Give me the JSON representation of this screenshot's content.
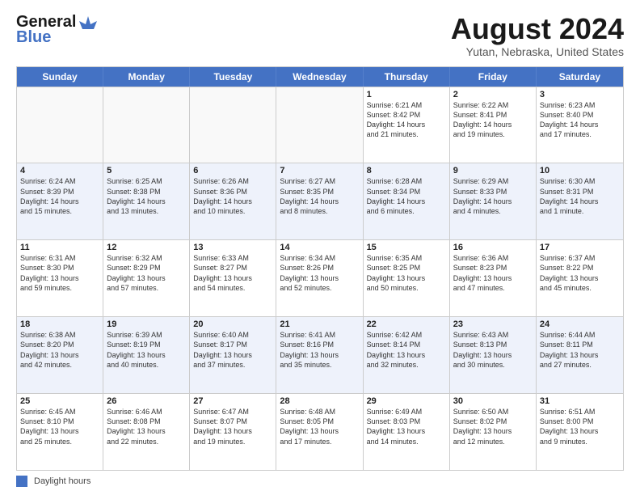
{
  "logo": {
    "line1": "General",
    "line2": "Blue"
  },
  "title": "August 2024",
  "location": "Yutan, Nebraska, United States",
  "days_of_week": [
    "Sunday",
    "Monday",
    "Tuesday",
    "Wednesday",
    "Thursday",
    "Friday",
    "Saturday"
  ],
  "legend_label": "Daylight hours",
  "weeks": [
    [
      {
        "day": "",
        "text": ""
      },
      {
        "day": "",
        "text": ""
      },
      {
        "day": "",
        "text": ""
      },
      {
        "day": "",
        "text": ""
      },
      {
        "day": "1",
        "text": "Sunrise: 6:21 AM\nSunset: 8:42 PM\nDaylight: 14 hours\nand 21 minutes."
      },
      {
        "day": "2",
        "text": "Sunrise: 6:22 AM\nSunset: 8:41 PM\nDaylight: 14 hours\nand 19 minutes."
      },
      {
        "day": "3",
        "text": "Sunrise: 6:23 AM\nSunset: 8:40 PM\nDaylight: 14 hours\nand 17 minutes."
      }
    ],
    [
      {
        "day": "4",
        "text": "Sunrise: 6:24 AM\nSunset: 8:39 PM\nDaylight: 14 hours\nand 15 minutes."
      },
      {
        "day": "5",
        "text": "Sunrise: 6:25 AM\nSunset: 8:38 PM\nDaylight: 14 hours\nand 13 minutes."
      },
      {
        "day": "6",
        "text": "Sunrise: 6:26 AM\nSunset: 8:36 PM\nDaylight: 14 hours\nand 10 minutes."
      },
      {
        "day": "7",
        "text": "Sunrise: 6:27 AM\nSunset: 8:35 PM\nDaylight: 14 hours\nand 8 minutes."
      },
      {
        "day": "8",
        "text": "Sunrise: 6:28 AM\nSunset: 8:34 PM\nDaylight: 14 hours\nand 6 minutes."
      },
      {
        "day": "9",
        "text": "Sunrise: 6:29 AM\nSunset: 8:33 PM\nDaylight: 14 hours\nand 4 minutes."
      },
      {
        "day": "10",
        "text": "Sunrise: 6:30 AM\nSunset: 8:31 PM\nDaylight: 14 hours\nand 1 minute."
      }
    ],
    [
      {
        "day": "11",
        "text": "Sunrise: 6:31 AM\nSunset: 8:30 PM\nDaylight: 13 hours\nand 59 minutes."
      },
      {
        "day": "12",
        "text": "Sunrise: 6:32 AM\nSunset: 8:29 PM\nDaylight: 13 hours\nand 57 minutes."
      },
      {
        "day": "13",
        "text": "Sunrise: 6:33 AM\nSunset: 8:27 PM\nDaylight: 13 hours\nand 54 minutes."
      },
      {
        "day": "14",
        "text": "Sunrise: 6:34 AM\nSunset: 8:26 PM\nDaylight: 13 hours\nand 52 minutes."
      },
      {
        "day": "15",
        "text": "Sunrise: 6:35 AM\nSunset: 8:25 PM\nDaylight: 13 hours\nand 50 minutes."
      },
      {
        "day": "16",
        "text": "Sunrise: 6:36 AM\nSunset: 8:23 PM\nDaylight: 13 hours\nand 47 minutes."
      },
      {
        "day": "17",
        "text": "Sunrise: 6:37 AM\nSunset: 8:22 PM\nDaylight: 13 hours\nand 45 minutes."
      }
    ],
    [
      {
        "day": "18",
        "text": "Sunrise: 6:38 AM\nSunset: 8:20 PM\nDaylight: 13 hours\nand 42 minutes."
      },
      {
        "day": "19",
        "text": "Sunrise: 6:39 AM\nSunset: 8:19 PM\nDaylight: 13 hours\nand 40 minutes."
      },
      {
        "day": "20",
        "text": "Sunrise: 6:40 AM\nSunset: 8:17 PM\nDaylight: 13 hours\nand 37 minutes."
      },
      {
        "day": "21",
        "text": "Sunrise: 6:41 AM\nSunset: 8:16 PM\nDaylight: 13 hours\nand 35 minutes."
      },
      {
        "day": "22",
        "text": "Sunrise: 6:42 AM\nSunset: 8:14 PM\nDaylight: 13 hours\nand 32 minutes."
      },
      {
        "day": "23",
        "text": "Sunrise: 6:43 AM\nSunset: 8:13 PM\nDaylight: 13 hours\nand 30 minutes."
      },
      {
        "day": "24",
        "text": "Sunrise: 6:44 AM\nSunset: 8:11 PM\nDaylight: 13 hours\nand 27 minutes."
      }
    ],
    [
      {
        "day": "25",
        "text": "Sunrise: 6:45 AM\nSunset: 8:10 PM\nDaylight: 13 hours\nand 25 minutes."
      },
      {
        "day": "26",
        "text": "Sunrise: 6:46 AM\nSunset: 8:08 PM\nDaylight: 13 hours\nand 22 minutes."
      },
      {
        "day": "27",
        "text": "Sunrise: 6:47 AM\nSunset: 8:07 PM\nDaylight: 13 hours\nand 19 minutes."
      },
      {
        "day": "28",
        "text": "Sunrise: 6:48 AM\nSunset: 8:05 PM\nDaylight: 13 hours\nand 17 minutes."
      },
      {
        "day": "29",
        "text": "Sunrise: 6:49 AM\nSunset: 8:03 PM\nDaylight: 13 hours\nand 14 minutes."
      },
      {
        "day": "30",
        "text": "Sunrise: 6:50 AM\nSunset: 8:02 PM\nDaylight: 13 hours\nand 12 minutes."
      },
      {
        "day": "31",
        "text": "Sunrise: 6:51 AM\nSunset: 8:00 PM\nDaylight: 13 hours\nand 9 minutes."
      }
    ]
  ]
}
